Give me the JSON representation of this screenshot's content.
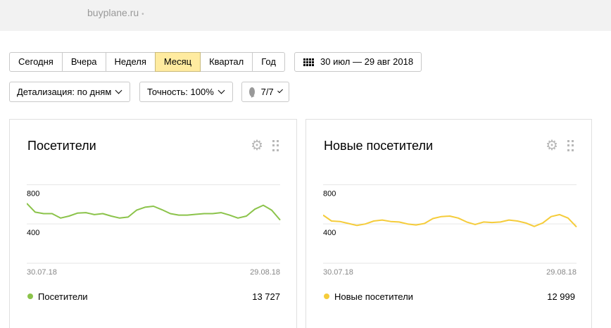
{
  "header": {
    "site": "buyplane.ru",
    "site_dot": "•"
  },
  "periods": [
    {
      "label": "Сегодня",
      "active": false
    },
    {
      "label": "Вчера",
      "active": false
    },
    {
      "label": "Неделя",
      "active": false
    },
    {
      "label": "Месяц",
      "active": true
    },
    {
      "label": "Квартал",
      "active": false
    },
    {
      "label": "Год",
      "active": false
    }
  ],
  "date_range": {
    "label": "30 июл — 29 авг 2018",
    "icon": "calendar-icon"
  },
  "filters": {
    "detail": "Детализация: по дням",
    "accuracy": "Точность: 100%",
    "segments": "7/7"
  },
  "widgets": [
    {
      "title": "Посетители",
      "color": "#8bc34a",
      "legend_label": "Посетители",
      "total": "13 727"
    },
    {
      "title": "Новые посетители",
      "color": "#f5cc3a",
      "legend_label": "Новые посетители",
      "total": "12 999"
    }
  ],
  "chart_data": [
    {
      "type": "line",
      "title": "Посетители",
      "x_start_label": "30.07.18",
      "x_end_label": "29.08.18",
      "ytick_labels": [
        "800",
        "400"
      ],
      "yticks": [
        800,
        400
      ],
      "ylim": [
        0,
        960
      ],
      "grid": true,
      "series": [
        {
          "name": "Посетители",
          "color": "#8bc34a",
          "values": [
            610,
            520,
            505,
            505,
            460,
            480,
            510,
            515,
            495,
            505,
            480,
            460,
            470,
            540,
            570,
            580,
            545,
            505,
            490,
            490,
            498,
            505,
            505,
            515,
            490,
            460,
            480,
            550,
            590,
            540,
            440
          ]
        }
      ]
    },
    {
      "type": "line",
      "title": "Новые посетители",
      "x_start_label": "30.07.18",
      "x_end_label": "29.08.18",
      "ytick_labels": [
        "800",
        "400"
      ],
      "yticks": [
        800,
        400
      ],
      "ylim": [
        0,
        960
      ],
      "grid": true,
      "series": [
        {
          "name": "Новые посетители",
          "color": "#f5cc3a",
          "values": [
            490,
            430,
            425,
            405,
            385,
            400,
            430,
            440,
            425,
            420,
            400,
            390,
            405,
            455,
            475,
            480,
            460,
            420,
            395,
            420,
            415,
            420,
            440,
            430,
            410,
            375,
            410,
            475,
            495,
            460,
            370
          ]
        }
      ]
    }
  ]
}
